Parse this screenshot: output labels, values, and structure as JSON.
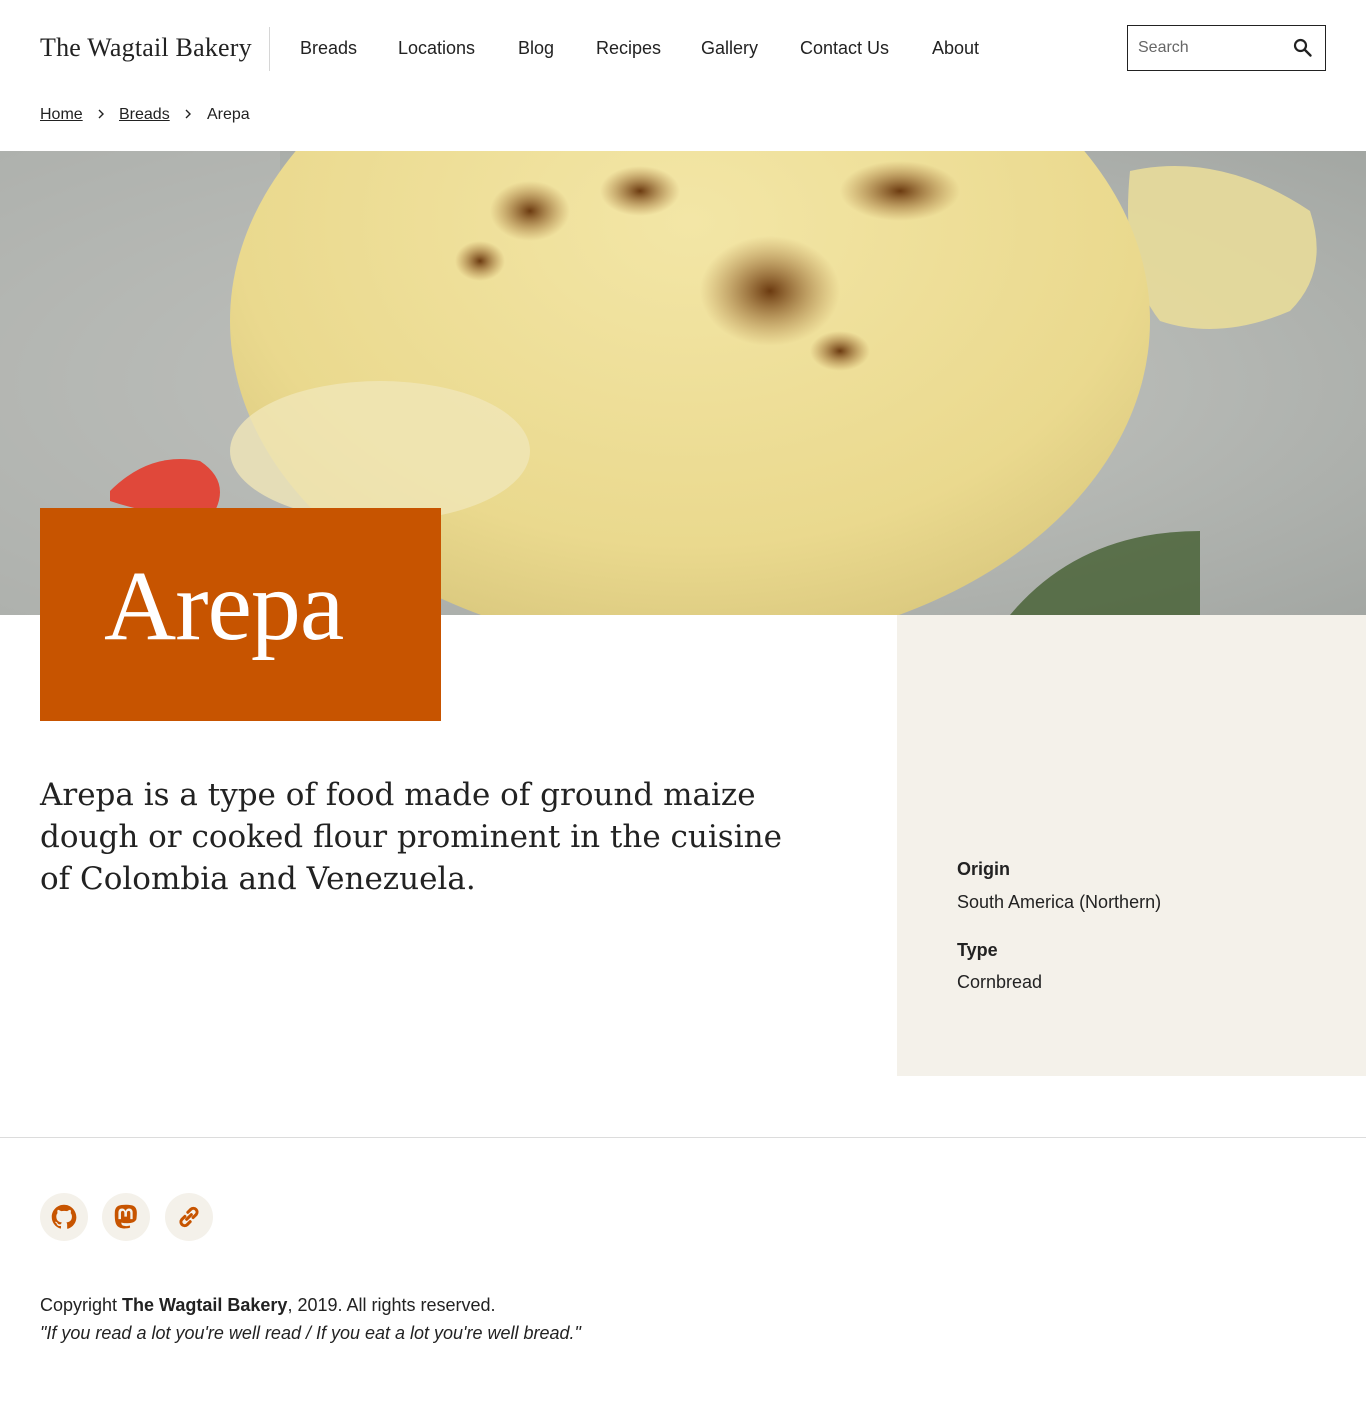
{
  "site": {
    "logo": "The Wagtail Bakery"
  },
  "nav": {
    "items": [
      "Breads",
      "Locations",
      "Blog",
      "Recipes",
      "Gallery",
      "Contact Us",
      "About"
    ]
  },
  "search": {
    "placeholder": "Search",
    "value": ""
  },
  "breadcrumb": {
    "home": "Home",
    "section": "Breads",
    "current": "Arepa"
  },
  "page": {
    "title": "Arepa",
    "intro": "Arepa is a type of food made of ground maize dough or cooked flour prominent in the cuisine of Colombia and Venezuela."
  },
  "details": {
    "origin_label": "Origin",
    "origin_value": "South America (Northern)",
    "type_label": "Type",
    "type_value": "Cornbread"
  },
  "footer": {
    "social_icons": [
      "github-icon",
      "mastodon-icon",
      "link-icon"
    ],
    "copyright_prefix": "Copyright ",
    "copyright_name": "The Wagtail Bakery",
    "copyright_suffix": ", 2019. All rights reserved.",
    "quote": "\"If you read a lot you're well read / If you eat a lot you're well bread.\""
  },
  "colors": {
    "accent": "#c75400",
    "sidebar_bg": "#f4f1ea",
    "text": "#222222"
  }
}
